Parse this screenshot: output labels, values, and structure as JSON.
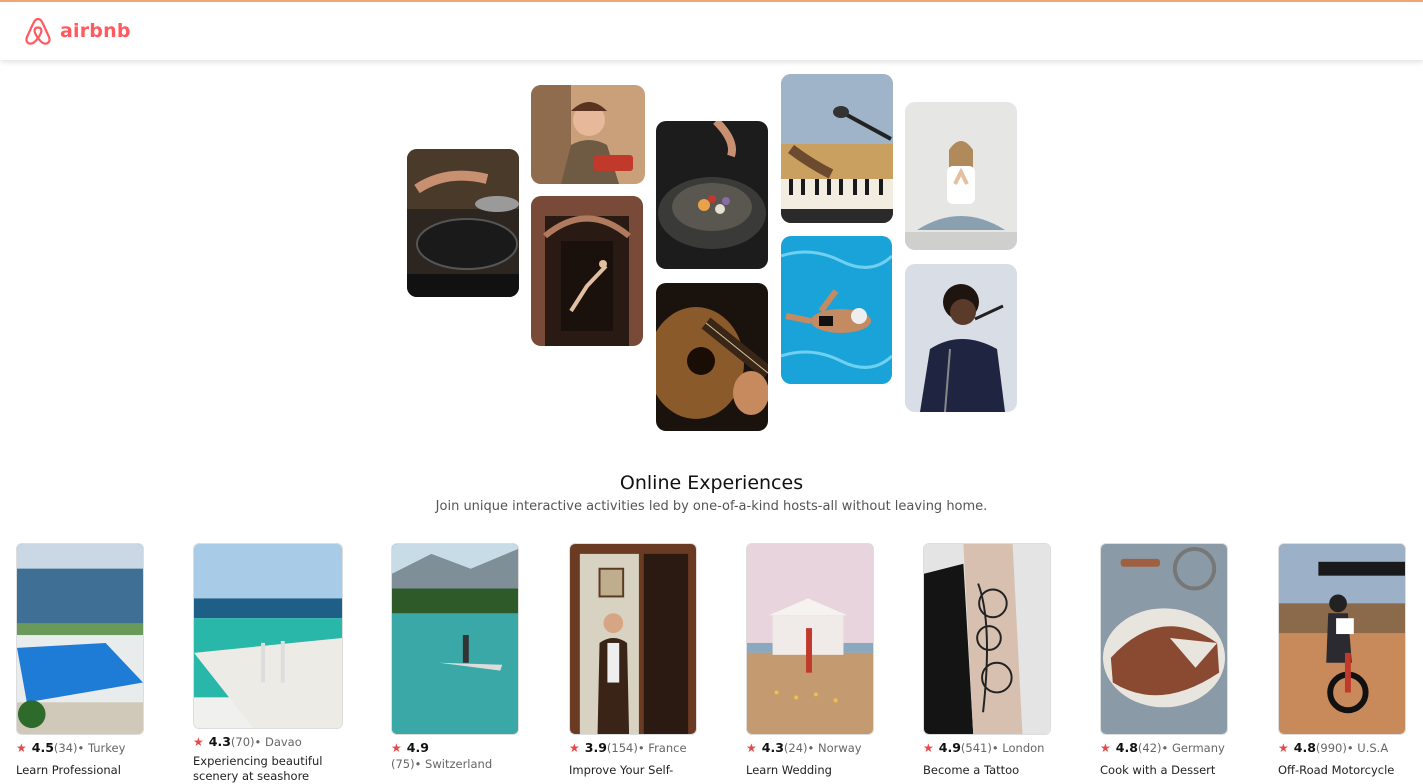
{
  "brand": {
    "name": "airbnb",
    "icon": "airbnb-logo-icon",
    "color": "#ff5a5f"
  },
  "hero": {
    "images": [
      {
        "name": "hero-photo-cooking-pans",
        "alt": "cooking"
      },
      {
        "name": "hero-photo-chef-sushi",
        "alt": "chef"
      },
      {
        "name": "hero-photo-dancer-doorway",
        "alt": "dancer"
      },
      {
        "name": "hero-photo-gourmet-bowl",
        "alt": "gourmet"
      },
      {
        "name": "hero-photo-guitar",
        "alt": "guitar"
      },
      {
        "name": "hero-photo-piano-mic",
        "alt": "music"
      },
      {
        "name": "hero-photo-swimmer",
        "alt": "swimming"
      },
      {
        "name": "hero-photo-yoga",
        "alt": "yoga"
      },
      {
        "name": "hero-photo-singer",
        "alt": "singer"
      }
    ]
  },
  "section": {
    "title": "Online Experiences",
    "subtitle": "Join unique interactive activities led by one-of-a-kind hosts-all without leaving home."
  },
  "cards": [
    {
      "rating": "4.5",
      "count": "(34)",
      "location": "• Turkey",
      "title": "Learn Professional"
    },
    {
      "rating": "4.3",
      "count": "(70)",
      "location": "• Davao",
      "title": "Experiencing beautiful",
      "title2": "scenery at seashore"
    },
    {
      "rating": "4.9",
      "count": "(75)",
      "location": "• Switzerland",
      "title": ""
    },
    {
      "rating": "3.9",
      "count": "(154)",
      "location": "• France",
      "title": "Improve Your Self-"
    },
    {
      "rating": "4.3",
      "count": "(24)",
      "location": "• Norway",
      "title": "Learn Wedding"
    },
    {
      "rating": "4.9",
      "count": "(541)",
      "location": "• London",
      "title": "Become a Tattoo"
    },
    {
      "rating": "4.8",
      "count": "(42)",
      "location": "• Germany",
      "title": "Cook with a Dessert"
    },
    {
      "rating": "4.8",
      "count": "(990)",
      "location": "• U.S.A",
      "title": "Off-Road Motorcycle"
    }
  ]
}
